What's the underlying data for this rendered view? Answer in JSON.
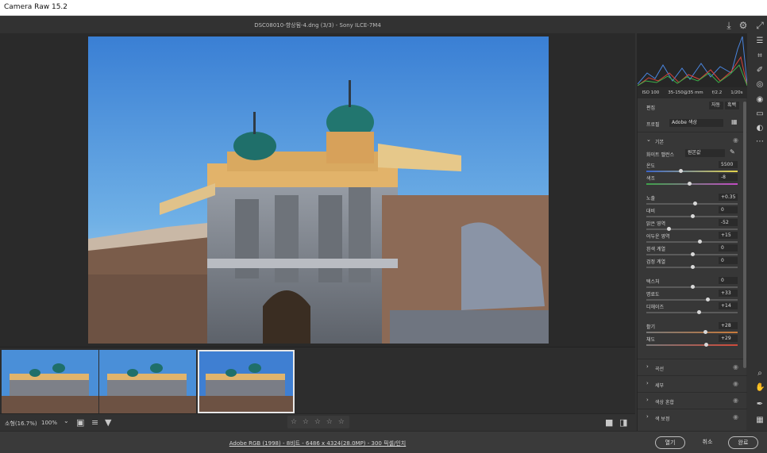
{
  "window": {
    "title": "Camera Raw 15.2"
  },
  "header": {
    "filename": "DSC08010-향상됨-4.dng (3/3)  -  Sony ILCE-7M4"
  },
  "toolbar": {
    "zoom_label": "소형(16.7%)",
    "zoom_value": "100%",
    "stars": "☆ ☆ ☆ ☆ ☆"
  },
  "footer": {
    "info": "Adobe RGB (1998) - 8비트 - 6486 x 4324(28.0MP) - 300 픽셀/인치",
    "open_label": "열기",
    "cancel_label": "취소",
    "done_label": "완료"
  },
  "panel": {
    "exif": {
      "iso": "ISO 100",
      "lens": "35-150@35 mm",
      "aperture": "f/2.2",
      "shutter": "1/20s"
    },
    "edit_label": "편집",
    "auto_label": "자동",
    "bw_label": "흑백",
    "profile_label": "프로필",
    "profile_value": "Adobe 색상",
    "basic_label": "기본",
    "wb_label": "화이트 밸런스",
    "wb_value": "원본값",
    "sliders": [
      {
        "label": "온도",
        "value": "5500",
        "pos": 0.37
      },
      {
        "label": "색조",
        "value": "-8",
        "pos": 0.47
      },
      {
        "label": "노출",
        "value": "+0.35",
        "pos": 0.53
      },
      {
        "label": "대비",
        "value": "0",
        "pos": 0.5
      },
      {
        "label": "밝은 영역",
        "value": "-52",
        "pos": 0.24
      },
      {
        "label": "어두운 영역",
        "value": "+15",
        "pos": 0.58
      },
      {
        "label": "흰색 계열",
        "value": "0",
        "pos": 0.5
      },
      {
        "label": "검정 계열",
        "value": "0",
        "pos": 0.5
      },
      {
        "label": "텍스처",
        "value": "0",
        "pos": 0.5
      },
      {
        "label": "명료도",
        "value": "+33",
        "pos": 0.67
      },
      {
        "label": "디헤이즈",
        "value": "+14",
        "pos": 0.57
      },
      {
        "label": "활기",
        "value": "+28",
        "pos": 0.64
      },
      {
        "label": "채도",
        "value": "+29",
        "pos": 0.65
      }
    ],
    "sections": [
      {
        "label": "곡선"
      },
      {
        "label": "세부"
      },
      {
        "label": "색상 혼합"
      },
      {
        "label": "색 보정"
      }
    ]
  },
  "colors": {
    "background": "#323232",
    "panel": "#373737",
    "accent": "#e8e8e8"
  },
  "icons": [
    "save-icon",
    "gear-icon",
    "fullscreen-icon",
    "edit-icon",
    "crop-icon",
    "heal-icon",
    "mask-icon",
    "redeye-icon",
    "snapshot-icon",
    "preset-icon",
    "more-icon",
    "zoom-icon",
    "hand-icon",
    "sampler-icon",
    "grid-icon",
    "filter-icon",
    "sort-icon",
    "compare-icon"
  ]
}
